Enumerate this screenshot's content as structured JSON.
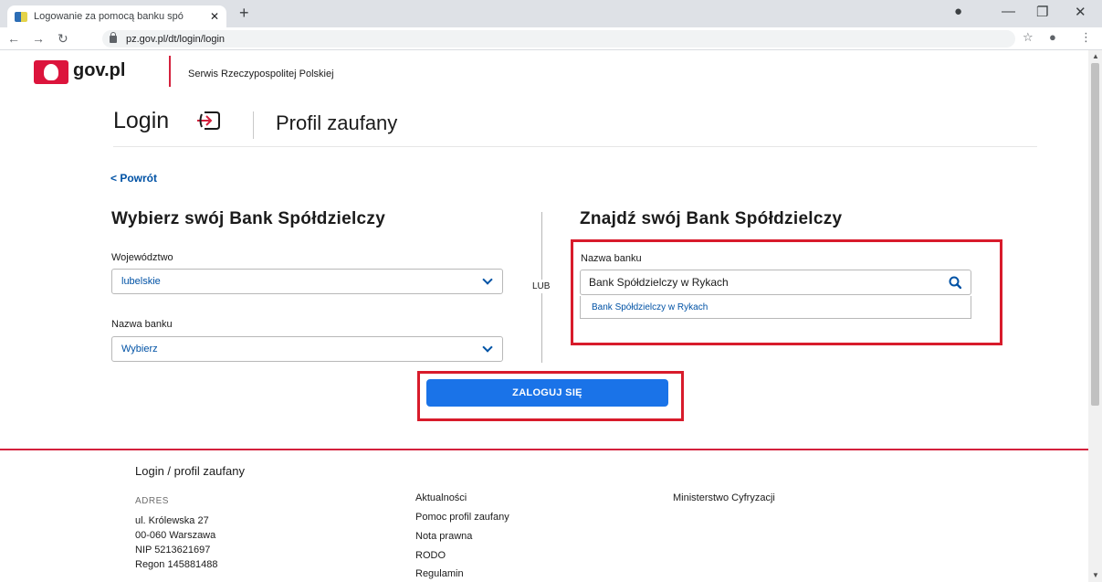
{
  "browser": {
    "tab_title": "Logowanie za pomocą banku spó",
    "tab_close": "✕",
    "new_tab": "+",
    "url": "pz.gov.pl/dt/login/login"
  },
  "header": {
    "brand": "gov.pl",
    "service": "Serwis Rzeczypospolitej Polskiej"
  },
  "title": {
    "login": "Login",
    "profile": "Profil zaufany"
  },
  "back_link": "< Powrót",
  "left": {
    "heading": "Wybierz swój Bank Spółdzielczy",
    "voivodeship_label": "Województwo",
    "voivodeship_value": "lubelskie",
    "bank_label": "Nazwa banku",
    "bank_value": "Wybierz"
  },
  "separator": "LUB",
  "right": {
    "heading": "Znajdź swój Bank Spółdzielczy",
    "bank_label": "Nazwa banku",
    "search_value": "Bank Spółdzielczy w Rykach",
    "suggestion": "Bank Spółdzielczy w Rykach"
  },
  "login_button": "ZALOGUJ SIĘ",
  "footer": {
    "title": "Login / profil zaufany",
    "address_heading": "ADRES",
    "address_lines": [
      "ul. Królewska 27",
      "00-060 Warszawa",
      "NIP 5213621697",
      "Regon 145881488"
    ],
    "links": [
      "Aktualności",
      "Pomoc profil zaufany",
      "Nota prawna",
      "RODO",
      "Regulamin"
    ],
    "ministry": "Ministerstwo Cyfryzacji"
  },
  "colors": {
    "accent_blue": "#1a73e8",
    "link_blue": "#0052a5",
    "highlight_red": "#d81b2b"
  }
}
